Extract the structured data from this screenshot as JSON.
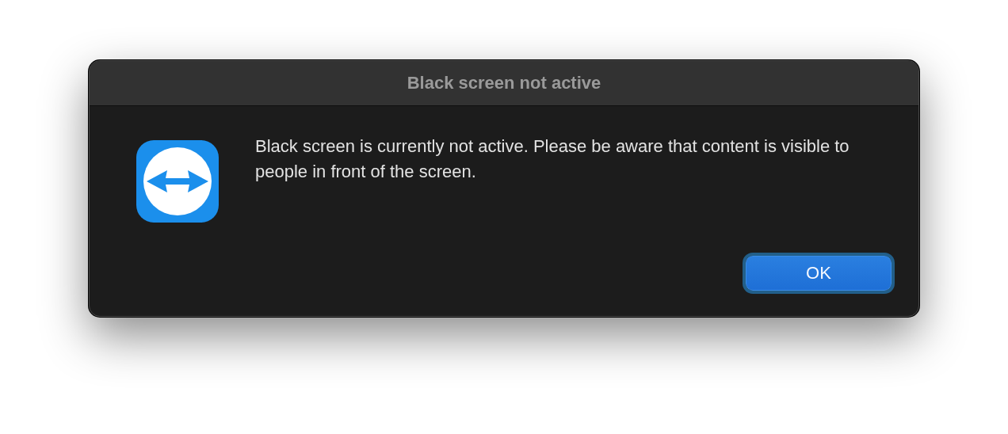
{
  "window": {
    "title": "Black screen not active"
  },
  "message": "Black screen is currently not active. Please be aware that content is visible to people in front of the screen.",
  "buttons": [
    {
      "label": "OK",
      "focused": true
    }
  ]
}
